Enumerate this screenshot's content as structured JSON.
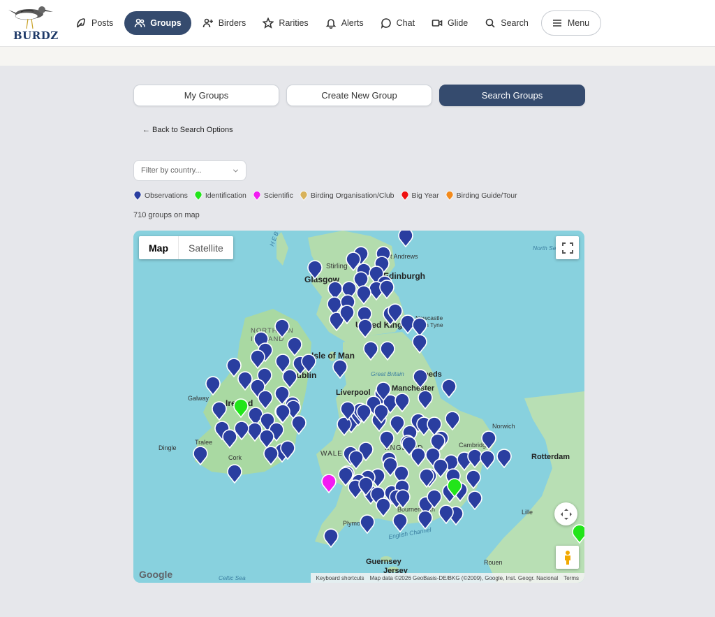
{
  "brand": {
    "name": "BURDZ"
  },
  "nav": {
    "items": [
      {
        "label": "Posts",
        "icon": "feather-icon",
        "active": false
      },
      {
        "label": "Groups",
        "icon": "users-icon",
        "active": true
      },
      {
        "label": "Birders",
        "icon": "user-plus-icon",
        "active": false
      },
      {
        "label": "Rarities",
        "icon": "star-icon",
        "active": false
      },
      {
        "label": "Alerts",
        "icon": "bell-icon",
        "active": false
      },
      {
        "label": "Chat",
        "icon": "chat-icon",
        "active": false
      },
      {
        "label": "Glide",
        "icon": "video-icon",
        "active": false
      },
      {
        "label": "Search",
        "icon": "search-icon",
        "active": false
      }
    ],
    "menu_label": "Menu"
  },
  "tabs": [
    {
      "label": "My Groups",
      "active": false
    },
    {
      "label": "Create New Group",
      "active": false
    },
    {
      "label": "Search Groups",
      "active": true
    }
  ],
  "back_link": "← Back to Search Options",
  "filter": {
    "placeholder": "Filter by country..."
  },
  "legend": [
    {
      "label": "Observations",
      "color": "#2a3ea0"
    },
    {
      "label": "Identification",
      "color": "#22e51a"
    },
    {
      "label": "Scientific",
      "color": "#f21cf2"
    },
    {
      "label": "Birding Organisation/Club",
      "color": "#d8b25a"
    },
    {
      "label": "Big Year",
      "color": "#ee1111"
    },
    {
      "label": "Birding Guide/Tour",
      "color": "#f28a1c"
    }
  ],
  "groups_count": "710 groups on map",
  "map": {
    "type_map": "Map",
    "type_satellite": "Satellite",
    "labels": {
      "stirling": "Stirling",
      "edinburgh": "Edinburgh",
      "glasgow": "Glasgow",
      "st_andrews": "St Andrews",
      "north_sea": "North Sea",
      "united_kingdom": "United Kingdom",
      "newcastle": "Newcastle upon Tyne",
      "northern_ireland": "NORTHERN IRELAND",
      "isle_of_man": "Isle of Man",
      "great_britain": "Great Britain",
      "galway": "Galway",
      "ireland": "Ireland",
      "dublin": "Dublin",
      "liverpool": "Liverpool",
      "manchester": "Manchester",
      "leeds": "Leeds",
      "norwich": "Norwich",
      "cambridge": "Cambridge",
      "dingle": "Dingle",
      "tralee": "Tralee",
      "cork": "Cork",
      "wales": "WALES",
      "england": "ENGLAND",
      "rotterdam": "Rotterdam",
      "lille": "Lille",
      "plymouth": "Plymouth",
      "bournemouth": "Bournemouth",
      "english_channel": "English Channel",
      "guernsey": "Guernsey",
      "jersey": "Jersey",
      "rouen": "Rouen",
      "celtic_sea": "Celtic Sea",
      "hebrides": "HEB"
    },
    "google": "Google",
    "attrib_shortcuts": "Keyboard shortcuts",
    "attrib_data": "Map data ©2026 GeoBasis-DE/BKG (©2009), Google, Inst. Geogr. Nacional",
    "attrib_terms": "Terms",
    "markers": {
      "observations": 139,
      "identification": 3,
      "scientific": 1
    }
  }
}
